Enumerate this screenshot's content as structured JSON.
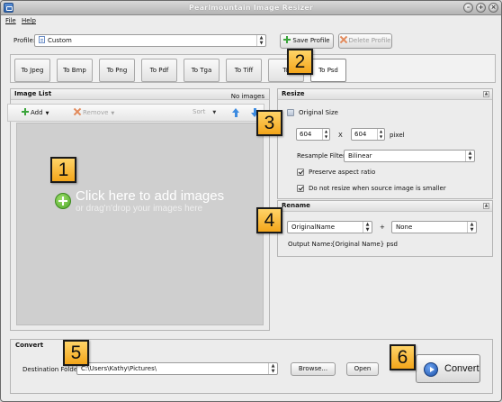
{
  "window": {
    "title": "Pearlmountain Image Resizer",
    "controls": [
      "minimize-icon",
      "maximize-icon",
      "close-icon"
    ]
  },
  "menu": {
    "file": "File",
    "help": "Help"
  },
  "profile": {
    "label": "Profile:",
    "value": "Custom",
    "save_label": "Save Profile",
    "delete_label": "Delete Profile"
  },
  "formats": [
    "To Jpeg",
    "To Bmp",
    "To Png",
    "To Pdf",
    "To Tga",
    "To Tiff",
    "To Gif",
    "To Psd"
  ],
  "formats_visible": [
    "To Jpeg",
    "To Bmp",
    "To Png",
    "To Pdf",
    "To Tga",
    "To Tiff",
    "To",
    "To Psd"
  ],
  "image_list": {
    "title": "Image List",
    "count_text": "No images",
    "add_label": "Add",
    "remove_label": "Remove",
    "sort_label": "Sort",
    "drop_main": "Click here  to add images",
    "drop_sub": "or drag'n'drop your images here"
  },
  "resize": {
    "title": "Resize",
    "original_size_label": "Original Size",
    "width": "604",
    "height": "604",
    "times": "X",
    "unit": "pixel",
    "filter_label": "Resample Filter:",
    "filter_value": "Bilinear",
    "preserve_ratio_label": "Preserve aspect ratio",
    "preserve_ratio_checked": true,
    "no_resize_smaller_label": "Do not resize when source image is smaller",
    "no_resize_smaller_checked": true
  },
  "rename": {
    "title": "Rename",
    "name_value": "OriginalName",
    "plus": "+",
    "suffix_value": "None",
    "output_label": "Output Name:",
    "output_value": "{Original Name} psd"
  },
  "convert": {
    "title": "Convert",
    "dest_label": "Destination Folder:",
    "dest_value": "C:\\Users\\Kathy\\Pictures\\",
    "browse_label": "Browse...",
    "open_label": "Open",
    "convert_label": "Convert"
  },
  "callouts": [
    "1",
    "2",
    "3",
    "4",
    "5",
    "6"
  ],
  "colors": {
    "callout_fill": "#f7b431",
    "dropzone": "#cfcfcf",
    "accent_blue": "#3d8be0",
    "add_green": "#3aa43a"
  }
}
